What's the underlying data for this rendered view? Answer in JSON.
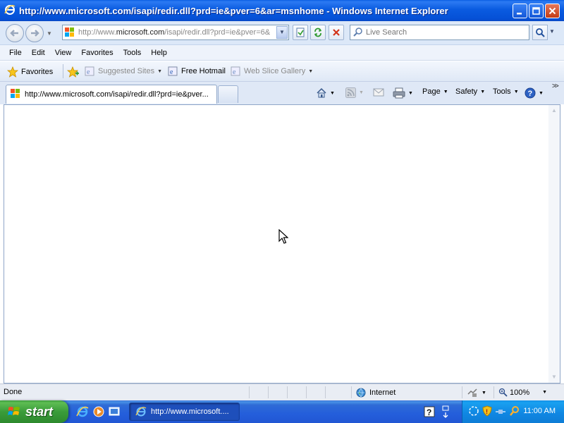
{
  "window": {
    "title": "http://www.microsoft.com/isapi/redir.dll?prd=ie&pver=6&ar=msnhome - Windows Internet Explorer"
  },
  "address_bar": {
    "url_prefix": "http://www.",
    "url_domain": "microsoft.com",
    "url_rest": "/isapi/redir.dll?prd=ie&pver=6&",
    "icon": "msn-favicon"
  },
  "search": {
    "placeholder": "Live Search"
  },
  "menu": {
    "items": [
      "File",
      "Edit",
      "View",
      "Favorites",
      "Tools",
      "Help"
    ]
  },
  "favorites_bar": {
    "favorites_label": "Favorites",
    "suggested_sites": "Suggested Sites",
    "free_hotmail": "Free Hotmail",
    "web_slice_gallery": "Web Slice Gallery"
  },
  "tab": {
    "title": "http://www.microsoft.com/isapi/redir.dll?prd=ie&pver..."
  },
  "command_bar": {
    "page": "Page",
    "safety": "Safety",
    "tools": "Tools"
  },
  "status_bar": {
    "status": "Done",
    "zone": "Internet",
    "zoom": "100%"
  },
  "taskbar": {
    "start_label": "start",
    "task_label": "http://www.microsoft....",
    "clock": "11:00 AM"
  },
  "colors": {
    "title_bar": "#0a5be0",
    "taskbar": "#245edb",
    "start_button": "#3a9c3a",
    "tray": "#0f86e2"
  }
}
